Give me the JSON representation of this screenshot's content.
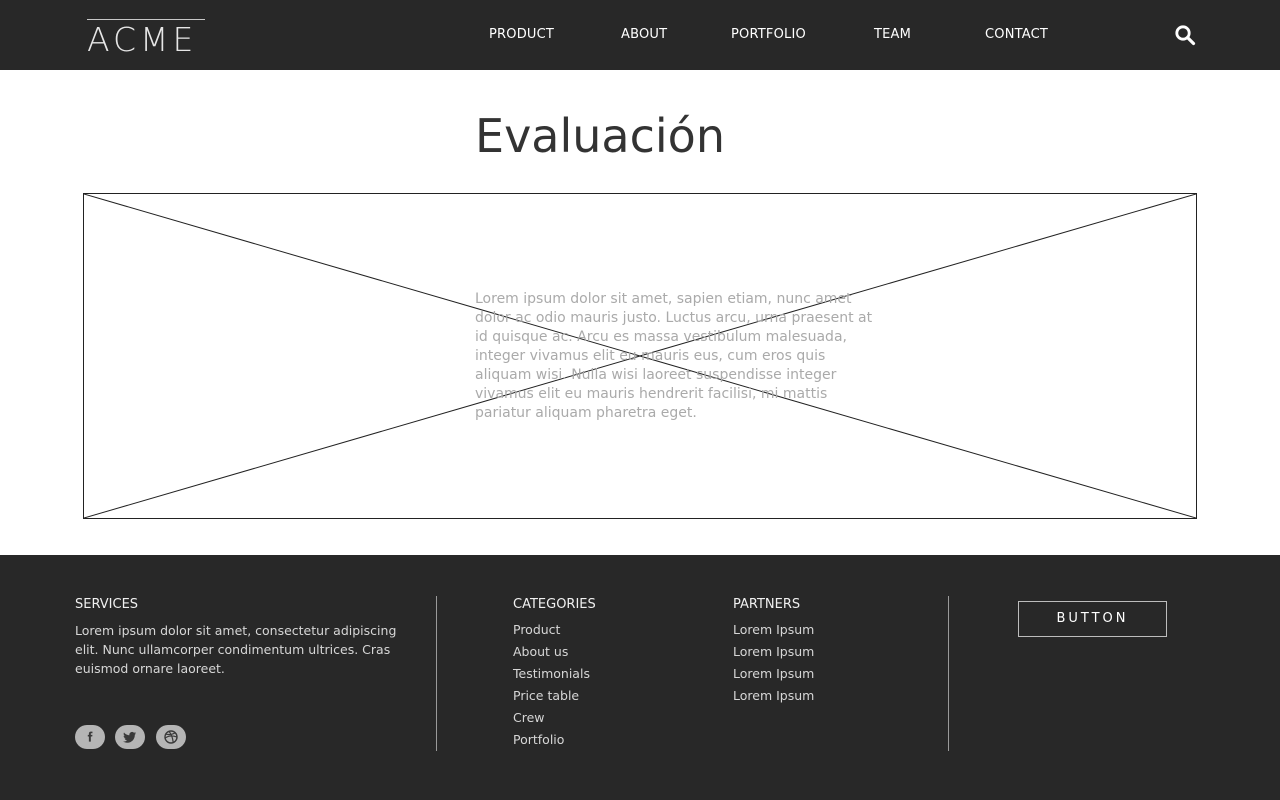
{
  "header": {
    "logo": "ACME",
    "nav": [
      "PRODUCT",
      "ABOUT",
      "PORTFOLIO",
      "TEAM",
      "CONTACT"
    ]
  },
  "main": {
    "title": "Evaluación",
    "placeholder_text": "Lorem ipsum dolor sit amet, sapien etiam, nunc amet dolor ac odio mauris justo. Luctus arcu, urna praesent at id quisque ac. Arcu es massa vestibulum malesuada, integer vivamus elit eu mauris eus, cum eros quis aliquam wisi. Nulla wisi laoreet suspendisse integer vivamus elit eu mauris hendrerit facilisi, mi mattis pariatur aliquam pharetra eget."
  },
  "footer": {
    "services": {
      "heading": "SERVICES",
      "text": "Lorem ipsum dolor sit amet, consectetur adipiscing elit. Nunc ullamcorper condimentum ultrices. Cras euismod ornare laoreet."
    },
    "categories": {
      "heading": "CATEGORIES",
      "items": [
        "Product",
        "About us",
        "Testimonials",
        "Price table",
        "Crew",
        "Portfolio"
      ]
    },
    "partners": {
      "heading": "PARTNERS",
      "items": [
        "Lorem Ipsum",
        "Lorem Ipsum",
        "Lorem Ipsum",
        "Lorem Ipsum"
      ]
    },
    "button_label": "BUTTON",
    "social": [
      "facebook-icon",
      "twitter-icon",
      "dribbble-icon"
    ]
  },
  "colors": {
    "dark_bar": "#282828",
    "title": "#333333",
    "placeholder_text": "#aaaaaa"
  }
}
